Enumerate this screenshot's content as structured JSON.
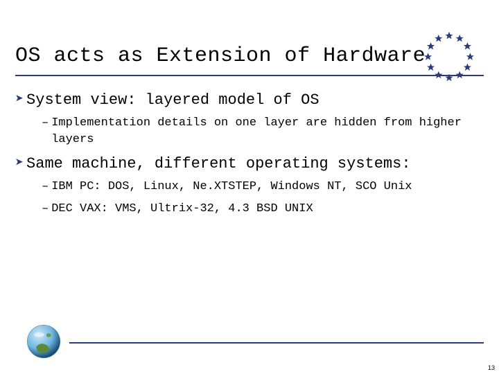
{
  "title": "OS acts as Extension of Hardware",
  "bullets": [
    {
      "text": "System view: layered model of OS",
      "sub": [
        "Implementation details on one layer are hidden from higher layers"
      ]
    },
    {
      "text": "Same machine, different operating systems:",
      "sub": [
        "IBM PC: DOS, Linux, Ne.XTSTEP, Windows NT, SCO Unix",
        "DEC VAX: VMS, Ultrix-32, 4.3 BSD UNIX"
      ]
    }
  ],
  "page_number": "13",
  "colors": {
    "accent": "#2c3a7a",
    "star": "#2c3a7a"
  }
}
